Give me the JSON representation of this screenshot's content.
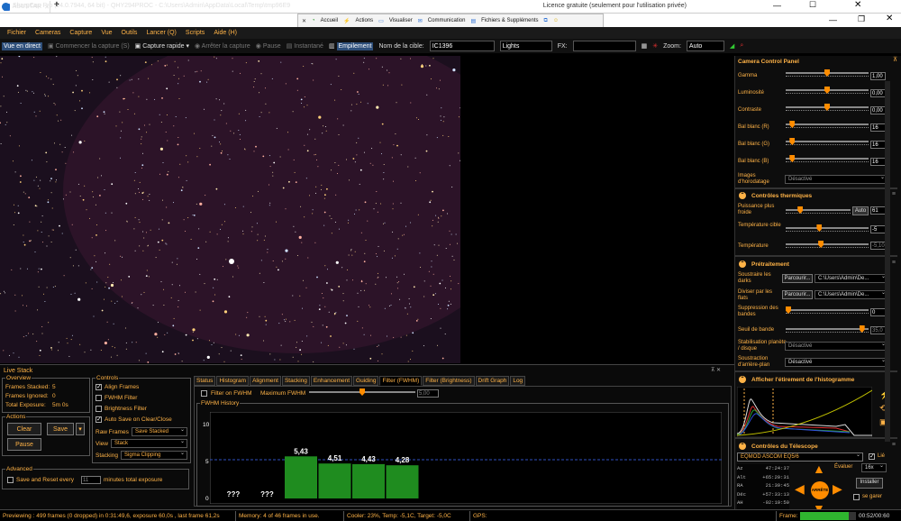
{
  "remote": {
    "tab_label": "ASUSTAR",
    "new_tab": "+",
    "license": "Licence gratuite (seulement pour l'utilisation privée)"
  },
  "title": {
    "text": "SharpCap Pro (v4.0.7944, 64 bit) - QHY294PROC - C:\\Users\\Admin\\AppData\\Local\\Temp\\tmp96E9"
  },
  "quick": {
    "accueil": "Accueil",
    "actions": "Actions",
    "visualiser": "Visualiser",
    "communication": "Communication",
    "fichiers": "Fichiers & Suppléments"
  },
  "menu": [
    "Fichier",
    "Cameras",
    "Capture",
    "Vue",
    "Outils",
    "Lancer (Q)",
    "Scripts",
    "Aide (H)"
  ],
  "toolbar": {
    "live": "Vue en direct",
    "start": "Commencer la capture (S)",
    "quick": "Capture rapide",
    "stop": "Arrêter la capture",
    "pause": "Pause",
    "snap": "Instantané",
    "stack": "Empilement",
    "target_label": "Nom de la cible:",
    "target_value": "IC1396",
    "target_type": "Lights",
    "fx_label": "FX:",
    "zoom_label": "Zoom:",
    "zoom_value": "Auto"
  },
  "camera_panel": {
    "title": "Camera Control Panel",
    "sliders": [
      {
        "label": "Gamma",
        "value": "1,00",
        "level": 0.5
      },
      {
        "label": "Luminosité",
        "value": "0,00",
        "level": 0.5
      },
      {
        "label": "Contraste",
        "value": "0,00",
        "level": 0.5
      },
      {
        "label": "Bal blanc (R)",
        "value": "16",
        "level": 0.05
      },
      {
        "label": "Bal blanc (G)",
        "value": "16",
        "level": 0.05
      },
      {
        "label": "Bal blanc (B)",
        "value": "16",
        "level": 0.05
      }
    ],
    "timestamp_label": "Images d'horodatage",
    "timestamp_value": "Désactivé"
  },
  "thermal": {
    "title": "Contrôles thermiques",
    "power_label": "Puissance plus froide",
    "power_btn": "Auto",
    "power_value": "61",
    "power_level": 0.2,
    "target_label": "Température cible",
    "target_value": "-5",
    "target_level": 0.4,
    "temp_label": "Température",
    "temp_value": "-5,10",
    "temp_level": 0.42
  },
  "preproc": {
    "title": "Prétraitement",
    "darks_label": "Soustraire les darks",
    "darks_btn": "Parcourir...",
    "darks_path": "C:\\Users\\Admin\\De...",
    "flats_label": "Diviser par les flats",
    "flats_btn": "Parcourir...",
    "flats_path": "C:\\Users\\Admin\\De...",
    "band_label": "Suppression des bandes",
    "band_value": "0",
    "band_level": 0.0,
    "threshold_label": "Seuil de bande",
    "threshold_value": "35,0",
    "threshold_level": 0.95,
    "stab_label": "Stabilisation planète / disque",
    "stab_value": "Désactivé",
    "bg_label": "Soustraction d'arrière-plan",
    "bg_value": "Désactivé"
  },
  "histo": {
    "title": "Afficher l'étirement de l'histogramme"
  },
  "telescope": {
    "title": "Contrôles du Télescope",
    "mount": "EQMOD ASCOM EQ5/6",
    "link": "Lié",
    "az_label": "Az",
    "az": "47:24:37",
    "alt_label": "Alt",
    "alt": "+65:20:31",
    "ra_label": "RA",
    "ra": "21:39:45",
    "dec_label": "Déc",
    "dec": "+57:33:13",
    "ah_label": "AH",
    "ah": "-02:19:50",
    "rate_label": "Évaluer",
    "rate": "16x",
    "install": "Installer",
    "park": "se garer",
    "stop_label": "ARRÊTE"
  },
  "livestack": {
    "title": "Live Stack",
    "overview_title": "Overview",
    "stacked_label": "Frames Stacked:",
    "stacked": "5",
    "ignored_label": "Frames Ignored:",
    "ignored": "0",
    "exposure_label": "Total Exposure:",
    "exposure": "5m 0s",
    "actions_title": "Actions",
    "clear": "Clear",
    "save": "Save",
    "pause": "Pause",
    "advanced_title": "Advanced",
    "save_reset": "Save and Reset every",
    "minutes": "11",
    "minutes_label": "minutes total exposure",
    "controls_title": "Controls",
    "align": "Align Frames",
    "fwhm": "FWHM Filter",
    "brightness": "Brightness Filter",
    "autosave": "Auto Save on Clear/Close",
    "raw_label": "Raw Frames",
    "raw_value": "Save Stacked",
    "view_label": "View",
    "view_value": "Stack",
    "stacking_label": "Stacking",
    "stacking_value": "Sigma Clipping",
    "tabs": [
      "Status",
      "Histogram",
      "Alignment",
      "Stacking",
      "Enhancement",
      "Guiding",
      "Filter (FWHM)",
      "Filter (Brightness)",
      "Drift Graph",
      "Log"
    ],
    "filter_on": "Filter on FWHM",
    "max_label": "Maximum FWHM",
    "max_value": "5,00",
    "history_title": "FWHM History"
  },
  "chart_data": {
    "type": "bar",
    "categories": [
      "1",
      "2",
      "3",
      "4",
      "5",
      "6"
    ],
    "values": [
      null,
      null,
      5.43,
      4.51,
      4.43,
      4.28
    ],
    "labels": [
      "???",
      "???",
      "5,43",
      "4,51",
      "4,43",
      "4,28"
    ],
    "ylim": [
      0,
      10
    ],
    "yticks": [
      "0",
      "5",
      "10"
    ],
    "threshold": 5.0,
    "colors": {
      "bar": "#1f8c1f",
      "threshold": "#3050c0"
    }
  },
  "status": {
    "preview": "Previewing : 499 frames (0 dropped) in 0:31:49,6, exposure 60,0s , last frame 61,2s",
    "memory": "Memory: 4 of 46 frames in use.",
    "cooler": "Cooler: 23%, Temp: -5,1C, Target: -5,0C",
    "gps": "GPS:",
    "frame_label": "Frame:",
    "time": "00:52/00:60"
  }
}
